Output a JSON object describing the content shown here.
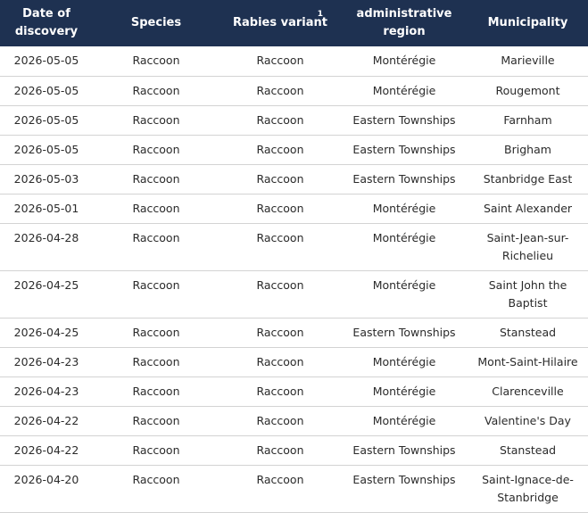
{
  "table": {
    "headers": {
      "date": "Date of discovery",
      "species": "Species",
      "variant": "Rabies variant",
      "variant_note": "1",
      "region": "administrative region",
      "municipality": "Municipality"
    },
    "rows": [
      {
        "date": "2026-05-05",
        "species": "Raccoon",
        "variant": "Raccoon",
        "region": "Montérégie",
        "municipality": "Marieville"
      },
      {
        "date": "2026-05-05",
        "species": "Raccoon",
        "variant": "Raccoon",
        "region": "Montérégie",
        "municipality": "Rougemont"
      },
      {
        "date": "2026-05-05",
        "species": "Raccoon",
        "variant": "Raccoon",
        "region": "Eastern Townships",
        "municipality": "Farnham"
      },
      {
        "date": "2026-05-05",
        "species": "Raccoon",
        "variant": "Raccoon",
        "region": "Eastern Townships",
        "municipality": "Brigham"
      },
      {
        "date": "2026-05-03",
        "species": "Raccoon",
        "variant": "Raccoon",
        "region": "Eastern Townships",
        "municipality": "Stanbridge East"
      },
      {
        "date": "2026-05-01",
        "species": "Raccoon",
        "variant": "Raccoon",
        "region": "Montérégie",
        "municipality": "Saint Alexander"
      },
      {
        "date": "2026-04-28",
        "species": "Raccoon",
        "variant": "Raccoon",
        "region": "Montérégie",
        "municipality": "Saint-Jean-sur-Richelieu"
      },
      {
        "date": "2026-04-25",
        "species": "Raccoon",
        "variant": "Raccoon",
        "region": "Montérégie",
        "municipality": "Saint John the Baptist"
      },
      {
        "date": "2026-04-25",
        "species": "Raccoon",
        "variant": "Raccoon",
        "region": "Eastern Townships",
        "municipality": "Stanstead"
      },
      {
        "date": "2026-04-23",
        "species": "Raccoon",
        "variant": "Raccoon",
        "region": "Montérégie",
        "municipality": "Mont-Saint-Hilaire"
      },
      {
        "date": "2026-04-23",
        "species": "Raccoon",
        "variant": "Raccoon",
        "region": "Montérégie",
        "municipality": "Clarenceville"
      },
      {
        "date": "2026-04-22",
        "species": "Raccoon",
        "variant": "Raccoon",
        "region": "Montérégie",
        "municipality": "Valentine's Day"
      },
      {
        "date": "2026-04-22",
        "species": "Raccoon",
        "variant": "Raccoon",
        "region": "Eastern Townships",
        "municipality": "Stanstead"
      },
      {
        "date": "2026-04-20",
        "species": "Raccoon",
        "variant": "Raccoon",
        "region": "Eastern Townships",
        "municipality": "Saint-Ignace-de-Stanbridge"
      }
    ]
  },
  "colors": {
    "header_bg": "#1e3151",
    "header_text": "#ffffff",
    "row_divider": "#d3d3d3"
  }
}
